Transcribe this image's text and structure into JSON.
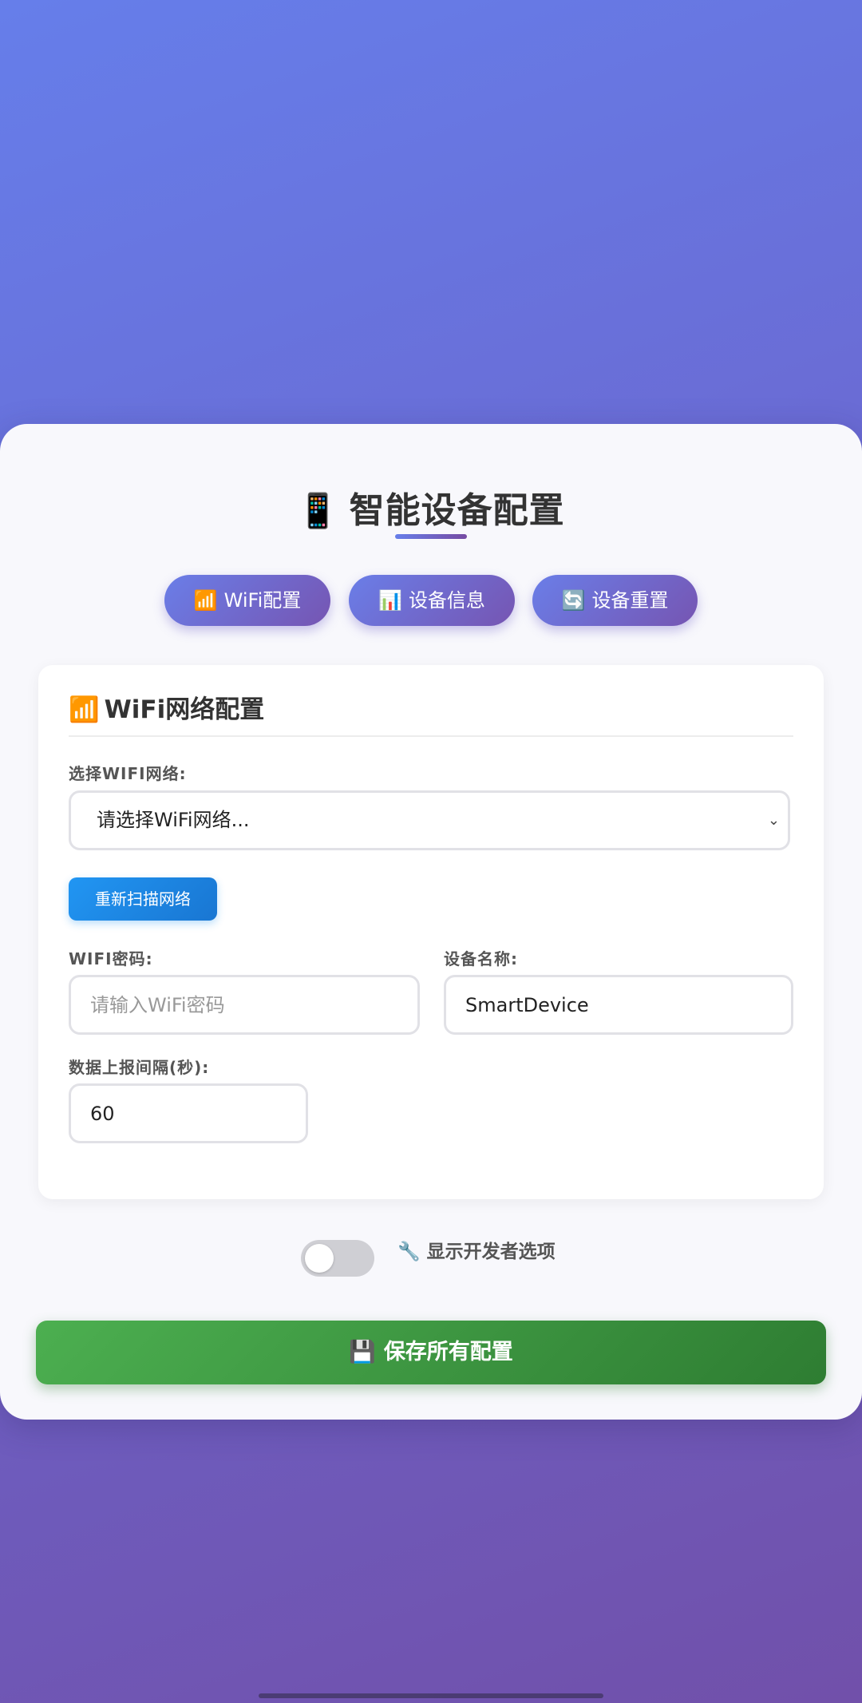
{
  "header": {
    "icon": "mobile-phone-icon",
    "icon_glyph": "📱",
    "title": "智能设备配置"
  },
  "tabs": [
    {
      "icon": "signal-bars-icon",
      "icon_glyph": "📶",
      "label": "WiFi配置"
    },
    {
      "icon": "bar-chart-icon",
      "icon_glyph": "📊",
      "label": "设备信息"
    },
    {
      "icon": "refresh-icon",
      "icon_glyph": "🔄",
      "label": "设备重置"
    }
  ],
  "wifi_section": {
    "icon": "signal-bars-icon",
    "icon_glyph": "📶",
    "title": "WiFi网络配置",
    "network_label": "选择WIFI网络:",
    "network_selected": "请选择WiFi网络...",
    "rescan_button": "重新扫描网络",
    "password_label": "WIFI密码:",
    "password_placeholder": "请输入WiFi密码",
    "password_value": "",
    "device_name_label": "设备名称:",
    "device_name_value": "SmartDevice",
    "interval_label": "数据上报间隔(秒):",
    "interval_value": "60"
  },
  "developer": {
    "toggle_on": false,
    "icon": "wrench-icon",
    "icon_glyph": "🔧",
    "label": "显示开发者选项"
  },
  "save": {
    "icon": "floppy-disk-icon",
    "icon_glyph": "💾",
    "label": "保存所有配置"
  },
  "colors": {
    "background_start": "#667eea",
    "background_end": "#764ba2",
    "tab_gradient_start": "#6a7ee8",
    "tab_gradient_end": "#7655b2",
    "rescan_button": "#2196f3",
    "save_button": "#4caf50"
  }
}
